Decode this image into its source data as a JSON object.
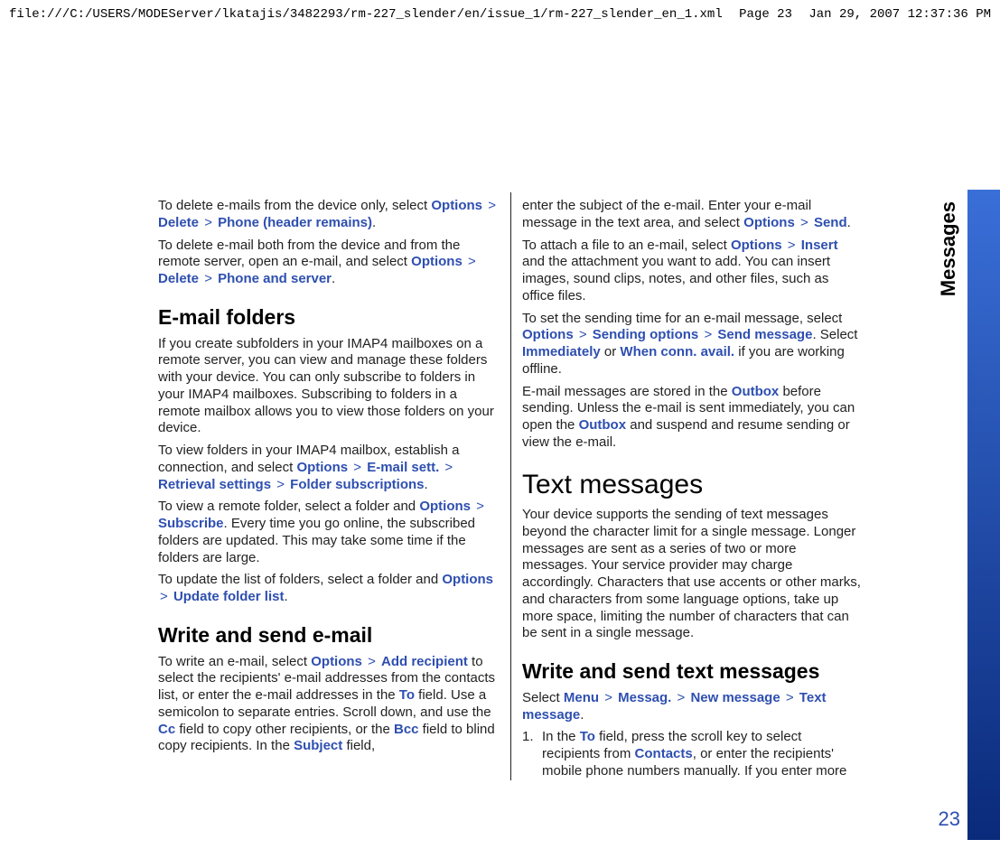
{
  "header": {
    "file_path": "file:///C:/USERS/MODEServer/lkatajis/3482293/rm-227_slender/en/issue_1/rm-227_slender_en_1.xml",
    "page_label": "Page 23",
    "timestamp": "Jan 29, 2007 12:37:36 PM"
  },
  "side_tab": "Messages",
  "page_number": "23",
  "left": {
    "p1_a": "To delete e-mails from the device only, select ",
    "p1_b": "Options",
    "p1_c": "Delete",
    "p1_d": "Phone (header remains)",
    "p1_e": ".",
    "p2_a": "To delete e-mail both from the device and from the remote server, open an e-mail, and select ",
    "p2_b": "Options",
    "p2_c": "Delete",
    "p2_d": "Phone and server",
    "p2_e": ".",
    "h_email_folders": "E-mail folders",
    "p3": "If you create subfolders in your IMAP4 mailboxes on a remote server, you can view and manage these folders with your device. You can only subscribe to folders in your IMAP4 mailboxes. Subscribing to folders in a remote mailbox allows you to view those folders on your device.",
    "p4_a": "To view folders in your IMAP4 mailbox, establish a connection, and select ",
    "p4_b": "Options",
    "p4_c": "E-mail sett.",
    "p4_d": "Retrieval settings",
    "p4_e": "Folder subscriptions",
    "p4_f": ".",
    "p5_a": "To view a remote folder, select a folder and ",
    "p5_b": "Options",
    "p5_c": "Subscribe",
    "p5_d": ". Every time you go online, the subscribed folders are updated. This may take some time if the folders are large.",
    "p6_a": "To update the list of folders, select a folder and ",
    "p6_b": "Options",
    "p6_c": "Update folder list",
    "p6_d": ".",
    "h_write_send_email": "Write and send e-mail",
    "p7_a": "To write an e-mail, select ",
    "p7_b": "Options",
    "p7_c": "Add recipient",
    "p7_d": " to select the recipients' e-mail addresses from the contacts list, or enter the e-mail addresses in the ",
    "p7_e": "To",
    "p7_f": " field. Use a semicolon to separate entries. Scroll down, and use the ",
    "p7_g": "Cc",
    "p7_h": " field to copy other recipients, or the ",
    "p7_i": "Bcc",
    "p7_j": " field to blind copy recipients. In the ",
    "p7_k": "Subject",
    "p7_l": " field,"
  },
  "right": {
    "p1_a": "enter the subject of the e-mail. Enter your e-mail message in the text area, and select ",
    "p1_b": "Options",
    "p1_c": "Send",
    "p1_d": ".",
    "p2_a": "To attach a file to an e-mail, select ",
    "p2_b": "Options",
    "p2_c": "Insert",
    "p2_d": " and the attachment you want to add. You can insert images, sound clips, notes, and other files, such as office files.",
    "p3_a": "To set the sending time for an e-mail message, select ",
    "p3_b": "Options",
    "p3_c": "Sending options",
    "p3_d": "Send message",
    "p3_e": ". Select ",
    "p3_f": "Immediately",
    "p3_g": " or ",
    "p3_h": "When conn. avail.",
    "p3_i": " if you are working offline.",
    "p4_a": "E-mail messages are stored in the ",
    "p4_b": "Outbox",
    "p4_c": " before sending. Unless the e-mail is sent immediately, you can open the ",
    "p4_d": "Outbox",
    "p4_e": " and suspend and resume sending or view the e-mail.",
    "h_text_messages": "Text messages",
    "p5": "Your device supports the sending of text messages beyond the character limit for a single message. Longer messages are sent as a series of two or more messages. Your service provider may charge accordingly. Characters that use accents or other marks, and characters from some language options, take up more space, limiting the number of characters that can be sent in a single message.",
    "h_write_send_text": "Write and send text messages",
    "p6_a": "Select ",
    "p6_b": "Menu",
    "p6_c": "Messag.",
    "p6_d": "New message",
    "p6_e": "Text message",
    "p6_f": ".",
    "li1_num": "1.",
    "li1_a": "In the ",
    "li1_b": "To",
    "li1_c": " field, press the scroll key to select recipients from ",
    "li1_d": "Contacts",
    "li1_e": ", or enter the recipients' mobile phone numbers manually. If you enter more"
  },
  "gt": ">"
}
